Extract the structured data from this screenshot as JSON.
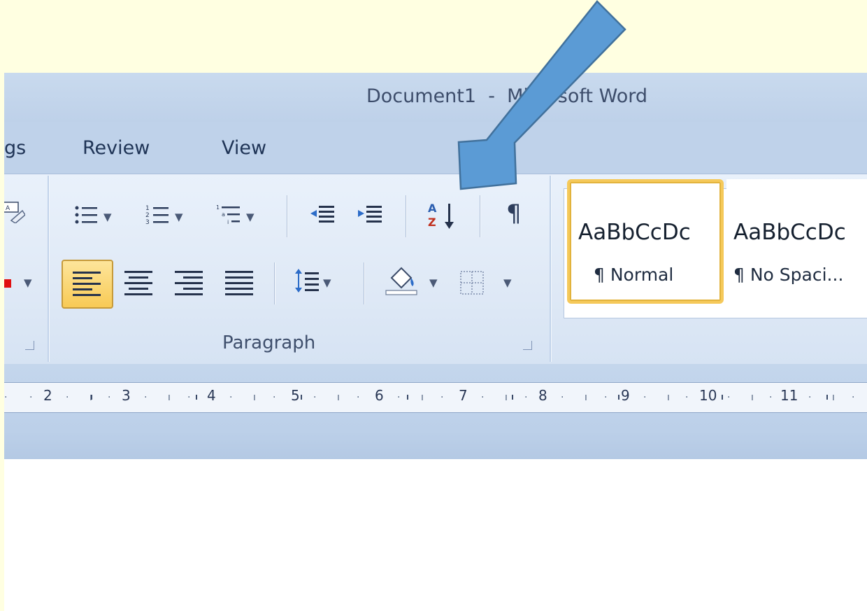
{
  "window": {
    "title": "Document1  -  Microsoft Word"
  },
  "tabs": [
    {
      "label": "gs"
    },
    {
      "label": "Review"
    },
    {
      "label": "View"
    }
  ],
  "groups": {
    "paragraph_label": "Paragraph"
  },
  "ruler": {
    "numbers": [
      "2",
      "3",
      "4",
      "5",
      "6",
      "7",
      "8",
      "9",
      "10",
      "11"
    ]
  },
  "styles": [
    {
      "sample": "AaBbCcDc",
      "name": "¶ Normal",
      "selected": true
    },
    {
      "sample": "AaBbCcDc",
      "name": "¶ No Spaci...",
      "selected": false
    }
  ],
  "icons": {
    "bullets": "bullets-icon",
    "numbering": "numbering-icon",
    "multilevel": "multilevel-list-icon",
    "decrease_indent": "decrease-indent-icon",
    "increase_indent": "increase-indent-icon",
    "sort": "sort-az-icon",
    "show_marks": "pilcrow-icon",
    "line_spacing": "line-spacing-icon",
    "shading": "shading-bucket-icon",
    "borders": "borders-icon",
    "arrow": "callout-arrow-icon"
  },
  "colors": {
    "background": "#ffffe1",
    "arrow": "#5b9bd5",
    "arrow_outline": "#41719c",
    "selected_highlight": "#f8ca55"
  }
}
